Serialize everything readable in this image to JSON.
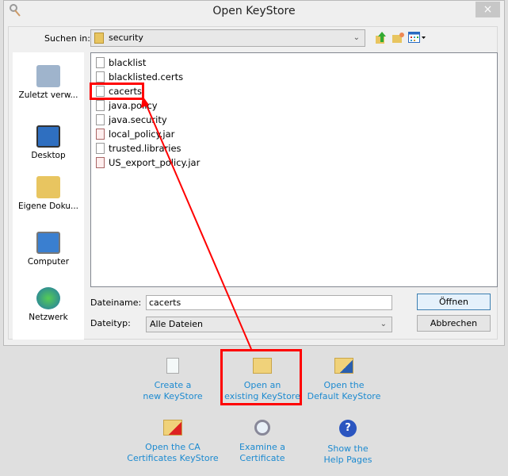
{
  "window": {
    "title": "Open KeyStore",
    "close": "×"
  },
  "toolbar": {
    "look_in_label": "Suchen in:",
    "look_in_value": "security"
  },
  "sidebar": {
    "items": [
      {
        "label": "Zuletzt verw..."
      },
      {
        "label": "Desktop"
      },
      {
        "label": "Eigene Doku..."
      },
      {
        "label": "Computer"
      },
      {
        "label": "Netzwerk"
      }
    ]
  },
  "files": [
    {
      "name": "blacklist",
      "type": "file"
    },
    {
      "name": "blacklisted.certs",
      "type": "file"
    },
    {
      "name": "cacerts",
      "type": "file"
    },
    {
      "name": "java.policy",
      "type": "file"
    },
    {
      "name": "java.security",
      "type": "file"
    },
    {
      "name": "local_policy.jar",
      "type": "jar"
    },
    {
      "name": "trusted.libraries",
      "type": "file"
    },
    {
      "name": "US_export_policy.jar",
      "type": "jar"
    }
  ],
  "filename": {
    "label": "Dateiname:",
    "value": "cacerts"
  },
  "filetype": {
    "label": "Dateityp:",
    "value": "Alle Dateien"
  },
  "buttons": {
    "open": "Öffnen",
    "cancel": "Abbrechen"
  },
  "actions": [
    {
      "line1": "Create a",
      "line2": "new KeyStore"
    },
    {
      "line1": "Open an",
      "line2": "existing KeyStore"
    },
    {
      "line1": "Open the",
      "line2": "Default KeyStore"
    },
    {
      "line1": "Open the CA",
      "line2": "Certificates KeyStore"
    },
    {
      "line1": "Examine a",
      "line2": "Certificate"
    },
    {
      "line1": "Show the",
      "line2": "Help Pages"
    }
  ],
  "colors": {
    "highlight": "#ff0000",
    "link": "#1c8ad0"
  }
}
